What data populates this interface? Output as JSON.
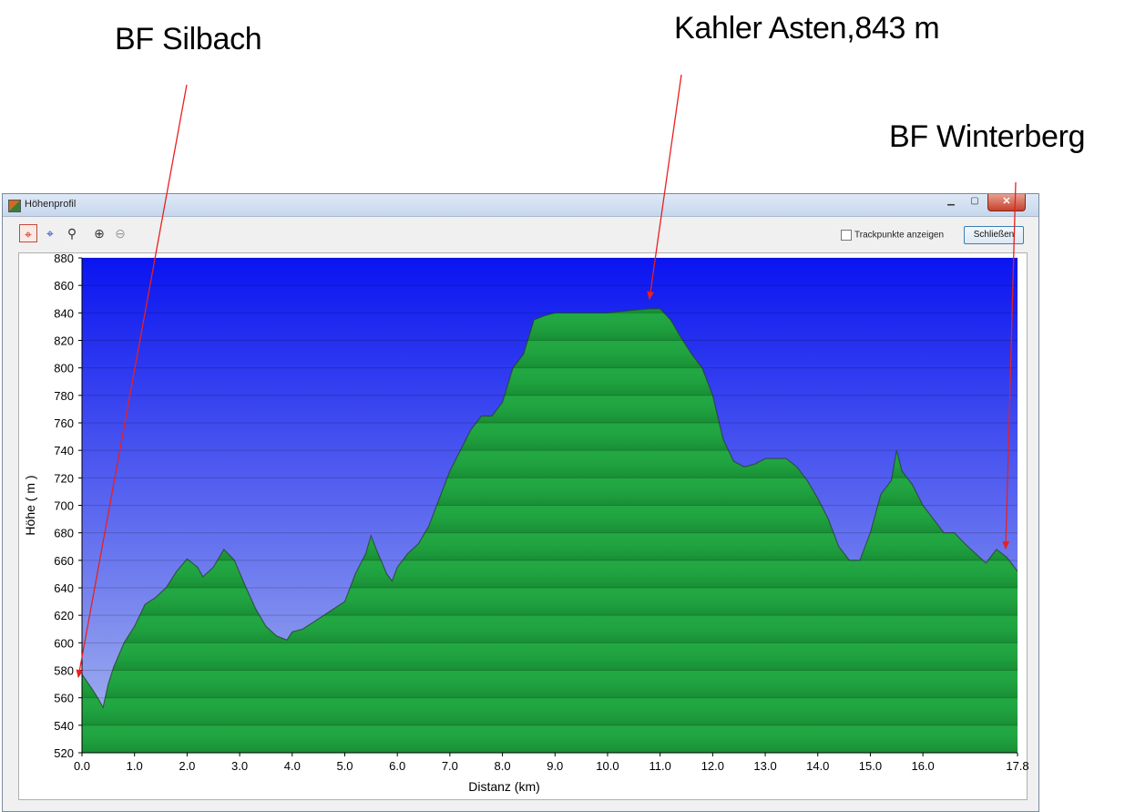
{
  "annotations": {
    "silbach": "BF Silbach",
    "asten": "Kahler Asten,843 m",
    "winterberg": "BF Winterberg"
  },
  "window": {
    "title": "Höhenprofil",
    "close_glyph": "✕",
    "checkbox_label": "Trackpunkte anzeigen",
    "close_button_label": "Schließen"
  },
  "toolbar": {
    "icons": [
      "crosshair-red-icon",
      "crosshair-blue-icon",
      "zoom-select-icon",
      "zoom-in-icon",
      "zoom-out-icon"
    ]
  },
  "colors": {
    "sky_top": "#0a14f0",
    "sky_bottom": "#a9b8ee",
    "fill": "#22a843",
    "fill_dark": "#178a33",
    "annotation_line": "#e82020"
  },
  "chart_data": {
    "type": "area",
    "xlabel": "Distanz  (km)",
    "ylabel": "Höhe ( m )",
    "xlim": [
      0,
      17.8
    ],
    "ylim": [
      520,
      880
    ],
    "x_ticks": [
      "0.0",
      "1.0",
      "2.0",
      "3.0",
      "4.0",
      "5.0",
      "6.0",
      "7.0",
      "8.0",
      "9.0",
      "10.0",
      "11.0",
      "12.0",
      "13.0",
      "14.0",
      "15.0",
      "16.0",
      "17.8"
    ],
    "y_ticks": [
      "520",
      "540",
      "560",
      "580",
      "600",
      "620",
      "640",
      "660",
      "680",
      "700",
      "720",
      "740",
      "760",
      "780",
      "800",
      "820",
      "840",
      "860",
      "880"
    ],
    "x": [
      0.0,
      0.2,
      0.3,
      0.4,
      0.5,
      0.6,
      0.8,
      1.0,
      1.2,
      1.4,
      1.6,
      1.8,
      2.0,
      2.2,
      2.3,
      2.5,
      2.7,
      2.9,
      3.1,
      3.3,
      3.5,
      3.7,
      3.9,
      4.0,
      4.2,
      4.4,
      4.6,
      4.8,
      5.0,
      5.2,
      5.4,
      5.5,
      5.6,
      5.8,
      5.9,
      6.0,
      6.2,
      6.4,
      6.6,
      6.8,
      7.0,
      7.2,
      7.4,
      7.6,
      7.8,
      8.0,
      8.2,
      8.4,
      8.6,
      8.8,
      9.0,
      9.5,
      10.0,
      10.5,
      10.8,
      11.0,
      11.2,
      11.4,
      11.6,
      11.8,
      12.0,
      12.2,
      12.4,
      12.6,
      12.8,
      13.0,
      13.2,
      13.4,
      13.6,
      13.8,
      14.0,
      14.2,
      14.4,
      14.6,
      14.8,
      15.0,
      15.2,
      15.4,
      15.5,
      15.6,
      15.8,
      16.0,
      16.2,
      16.4,
      16.6,
      16.8,
      17.0,
      17.2,
      17.4,
      17.6,
      17.8
    ],
    "y": [
      577,
      566,
      560,
      553,
      570,
      582,
      600,
      612,
      628,
      633,
      640,
      652,
      661,
      655,
      648,
      655,
      668,
      660,
      642,
      625,
      612,
      605,
      602,
      608,
      610,
      615,
      620,
      625,
      630,
      650,
      665,
      678,
      668,
      650,
      645,
      655,
      665,
      672,
      685,
      705,
      725,
      740,
      755,
      765,
      765,
      775,
      800,
      810,
      835,
      838,
      840,
      840,
      840,
      842,
      843,
      843,
      835,
      822,
      810,
      800,
      780,
      748,
      732,
      728,
      730,
      734,
      734,
      734,
      728,
      718,
      705,
      690,
      670,
      660,
      660,
      680,
      708,
      718,
      740,
      725,
      715,
      700,
      690,
      680,
      680,
      672,
      665,
      658,
      668,
      662,
      652
    ],
    "grid": true
  }
}
